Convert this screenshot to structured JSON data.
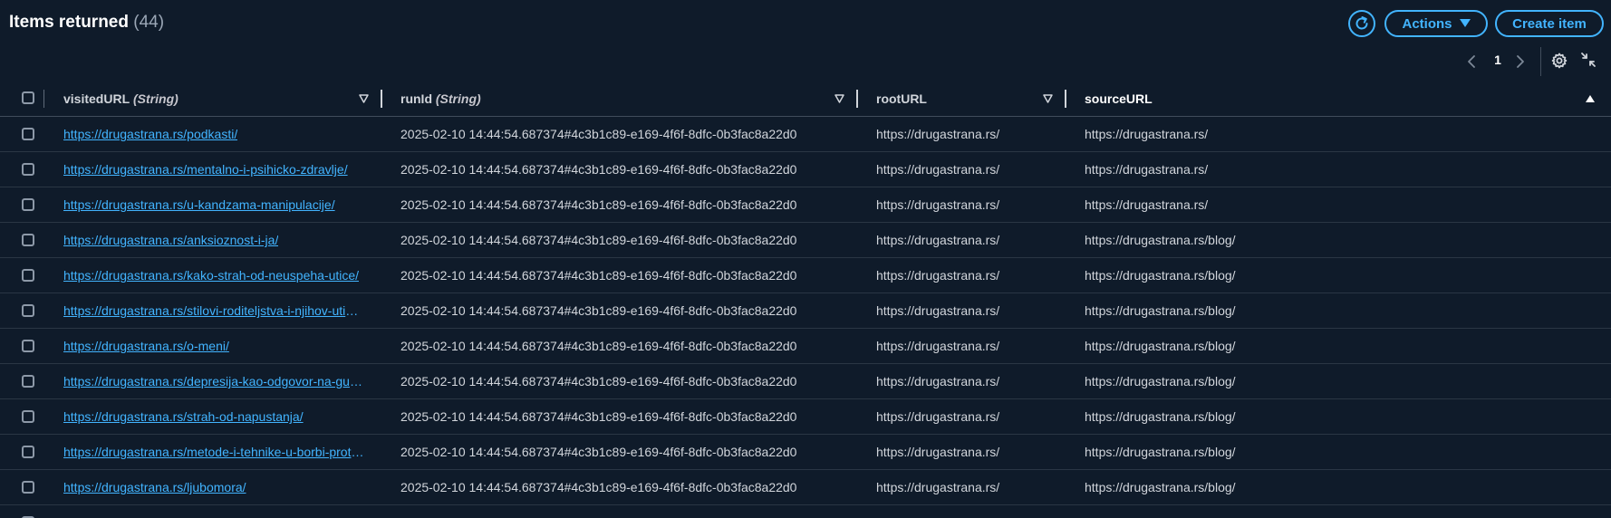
{
  "header": {
    "title": "Items returned",
    "count": "(44)",
    "actions_label": "Actions",
    "create_label": "Create item"
  },
  "pager": {
    "page": "1"
  },
  "columns": [
    {
      "name": "visitedURL",
      "type": "(String)"
    },
    {
      "name": "runId",
      "type": "(String)"
    },
    {
      "name": "rootURL",
      "type": ""
    },
    {
      "name": "sourceURL",
      "type": ""
    }
  ],
  "rows": [
    {
      "visitedURL": "https://drugastrana.rs/podkasti/",
      "runId": "2025-02-10 14:44:54.687374#4c3b1c89-e169-4f6f-8dfc-0b3fac8a22d0",
      "rootURL": "https://drugastrana.rs/",
      "sourceURL": "https://drugastrana.rs/"
    },
    {
      "visitedURL": "https://drugastrana.rs/mentalno-i-psihicko-zdravlje/",
      "runId": "2025-02-10 14:44:54.687374#4c3b1c89-e169-4f6f-8dfc-0b3fac8a22d0",
      "rootURL": "https://drugastrana.rs/",
      "sourceURL": "https://drugastrana.rs/"
    },
    {
      "visitedURL": "https://drugastrana.rs/u-kandzama-manipulacije/",
      "runId": "2025-02-10 14:44:54.687374#4c3b1c89-e169-4f6f-8dfc-0b3fac8a22d0",
      "rootURL": "https://drugastrana.rs/",
      "sourceURL": "https://drugastrana.rs/"
    },
    {
      "visitedURL": "https://drugastrana.rs/anksioznost-i-ja/",
      "runId": "2025-02-10 14:44:54.687374#4c3b1c89-e169-4f6f-8dfc-0b3fac8a22d0",
      "rootURL": "https://drugastrana.rs/",
      "sourceURL": "https://drugastrana.rs/blog/"
    },
    {
      "visitedURL": "https://drugastrana.rs/kako-strah-od-neuspeha-utice/",
      "runId": "2025-02-10 14:44:54.687374#4c3b1c89-e169-4f6f-8dfc-0b3fac8a22d0",
      "rootURL": "https://drugastrana.rs/",
      "sourceURL": "https://drugastrana.rs/blog/"
    },
    {
      "visitedURL": "https://drugastrana.rs/stilovi-roditeljstva-i-njihov-uticaj/",
      "runId": "2025-02-10 14:44:54.687374#4c3b1c89-e169-4f6f-8dfc-0b3fac8a22d0",
      "rootURL": "https://drugastrana.rs/",
      "sourceURL": "https://drugastrana.rs/blog/"
    },
    {
      "visitedURL": "https://drugastrana.rs/o-meni/",
      "runId": "2025-02-10 14:44:54.687374#4c3b1c89-e169-4f6f-8dfc-0b3fac8a22d0",
      "rootURL": "https://drugastrana.rs/",
      "sourceURL": "https://drugastrana.rs/blog/"
    },
    {
      "visitedURL": "https://drugastrana.rs/depresija-kao-odgovor-na-gubitak/",
      "runId": "2025-02-10 14:44:54.687374#4c3b1c89-e169-4f6f-8dfc-0b3fac8a22d0",
      "rootURL": "https://drugastrana.rs/",
      "sourceURL": "https://drugastrana.rs/blog/"
    },
    {
      "visitedURL": "https://drugastrana.rs/strah-od-napustanja/",
      "runId": "2025-02-10 14:44:54.687374#4c3b1c89-e169-4f6f-8dfc-0b3fac8a22d0",
      "rootURL": "https://drugastrana.rs/",
      "sourceURL": "https://drugastrana.rs/blog/"
    },
    {
      "visitedURL": "https://drugastrana.rs/metode-i-tehnike-u-borbi-protiv-stresa/",
      "runId": "2025-02-10 14:44:54.687374#4c3b1c89-e169-4f6f-8dfc-0b3fac8a22d0",
      "rootURL": "https://drugastrana.rs/",
      "sourceURL": "https://drugastrana.rs/blog/"
    },
    {
      "visitedURL": "https://drugastrana.rs/ljubomora/",
      "runId": "2025-02-10 14:44:54.687374#4c3b1c89-e169-4f6f-8dfc-0b3fac8a22d0",
      "rootURL": "https://drugastrana.rs/",
      "sourceURL": "https://drugastrana.rs/blog/"
    },
    {
      "visitedURL": "",
      "runId": "",
      "rootURL": "",
      "sourceURL": ""
    }
  ],
  "colors": {
    "background": "#0f1b2a",
    "accent": "#42b4ff",
    "text": "#d1d5db",
    "divider": "#2a3644"
  },
  "icons": {
    "refresh": "refresh-icon",
    "actions_caret": "caret-down-icon",
    "prev": "chevron-left-icon",
    "next": "chevron-right-icon",
    "settings": "gear-icon",
    "collapse": "collapse-icon",
    "filter": "filter-triangle-icon",
    "sort": "sort-ascending-icon"
  }
}
